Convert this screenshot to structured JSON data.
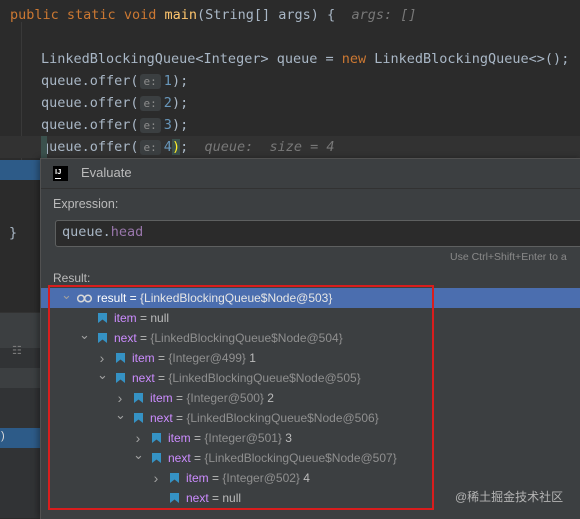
{
  "editor": {
    "main_line": {
      "kw1": "public",
      "kw2": "static",
      "kw3": "void",
      "fn": "main",
      "params": "(String[] args) {",
      "hint": "args: []"
    },
    "decl_line": {
      "type": "LinkedBlockingQueue<Integer> queue = ",
      "kw": "new",
      "rest": " LinkedBlockingQueue<>();"
    },
    "offer_calls": [
      {
        "prefix": "queue.offer(",
        "param_hint": "e:",
        "value": "1",
        "suffix": ");"
      },
      {
        "prefix": "queue.offer(",
        "param_hint": "e:",
        "value": "2",
        "suffix": ");"
      },
      {
        "prefix": "queue.offer(",
        "param_hint": "e:",
        "value": "3",
        "suffix": ");"
      },
      {
        "prefix": "queue.offer(",
        "param_hint": "e:",
        "value": "4",
        "suffix": ");",
        "inline_hint": "queue:  size = 4"
      }
    ],
    "closing_brace": "}"
  },
  "evaluate": {
    "title": "Evaluate",
    "expression_label": "Expression:",
    "expression": {
      "object": "queue.",
      "field": "head"
    },
    "shortcut_hint": "Use Ctrl+Shift+Enter to a",
    "result_label": "Result:",
    "tree": [
      {
        "name": "result",
        "type": "{LinkedBlockingQueue$Node@503}",
        "value": "",
        "icon": "watch-result-icon",
        "arrow": "expanded"
      },
      {
        "name": "item",
        "type": "",
        "value": "null",
        "icon": "field-flag-icon",
        "arrow": "none"
      },
      {
        "name": "next",
        "type": "{LinkedBlockingQueue$Node@504}",
        "value": "",
        "icon": "field-flag-icon",
        "arrow": "expanded"
      },
      {
        "name": "item",
        "type": "{Integer@499}",
        "value": "1",
        "icon": "field-flag-icon",
        "arrow": "collapsed"
      },
      {
        "name": "next",
        "type": "{LinkedBlockingQueue$Node@505}",
        "value": "",
        "icon": "field-flag-icon",
        "arrow": "expanded"
      },
      {
        "name": "item",
        "type": "{Integer@500}",
        "value": "2",
        "icon": "field-flag-icon",
        "arrow": "collapsed"
      },
      {
        "name": "next",
        "type": "{LinkedBlockingQueue$Node@506}",
        "value": "",
        "icon": "field-flag-icon",
        "arrow": "expanded"
      },
      {
        "name": "item",
        "type": "{Integer@501}",
        "value": "3",
        "icon": "field-flag-icon",
        "arrow": "collapsed"
      },
      {
        "name": "next",
        "type": "{LinkedBlockingQueue$Node@507}",
        "value": "",
        "icon": "field-flag-icon",
        "arrow": "expanded"
      },
      {
        "name": "item",
        "type": "{Integer@502}",
        "value": "4",
        "icon": "field-flag-icon",
        "arrow": "collapsed"
      },
      {
        "name": "next",
        "type": "",
        "value": "null",
        "icon": "field-flag-icon",
        "arrow": "none"
      }
    ]
  },
  "watermark": "@稀土掘金技术社区",
  "colors": {
    "accent_selection": "#4b6eaf",
    "highlight_box": "#d91d1d",
    "field_flag": "#3592c4"
  }
}
